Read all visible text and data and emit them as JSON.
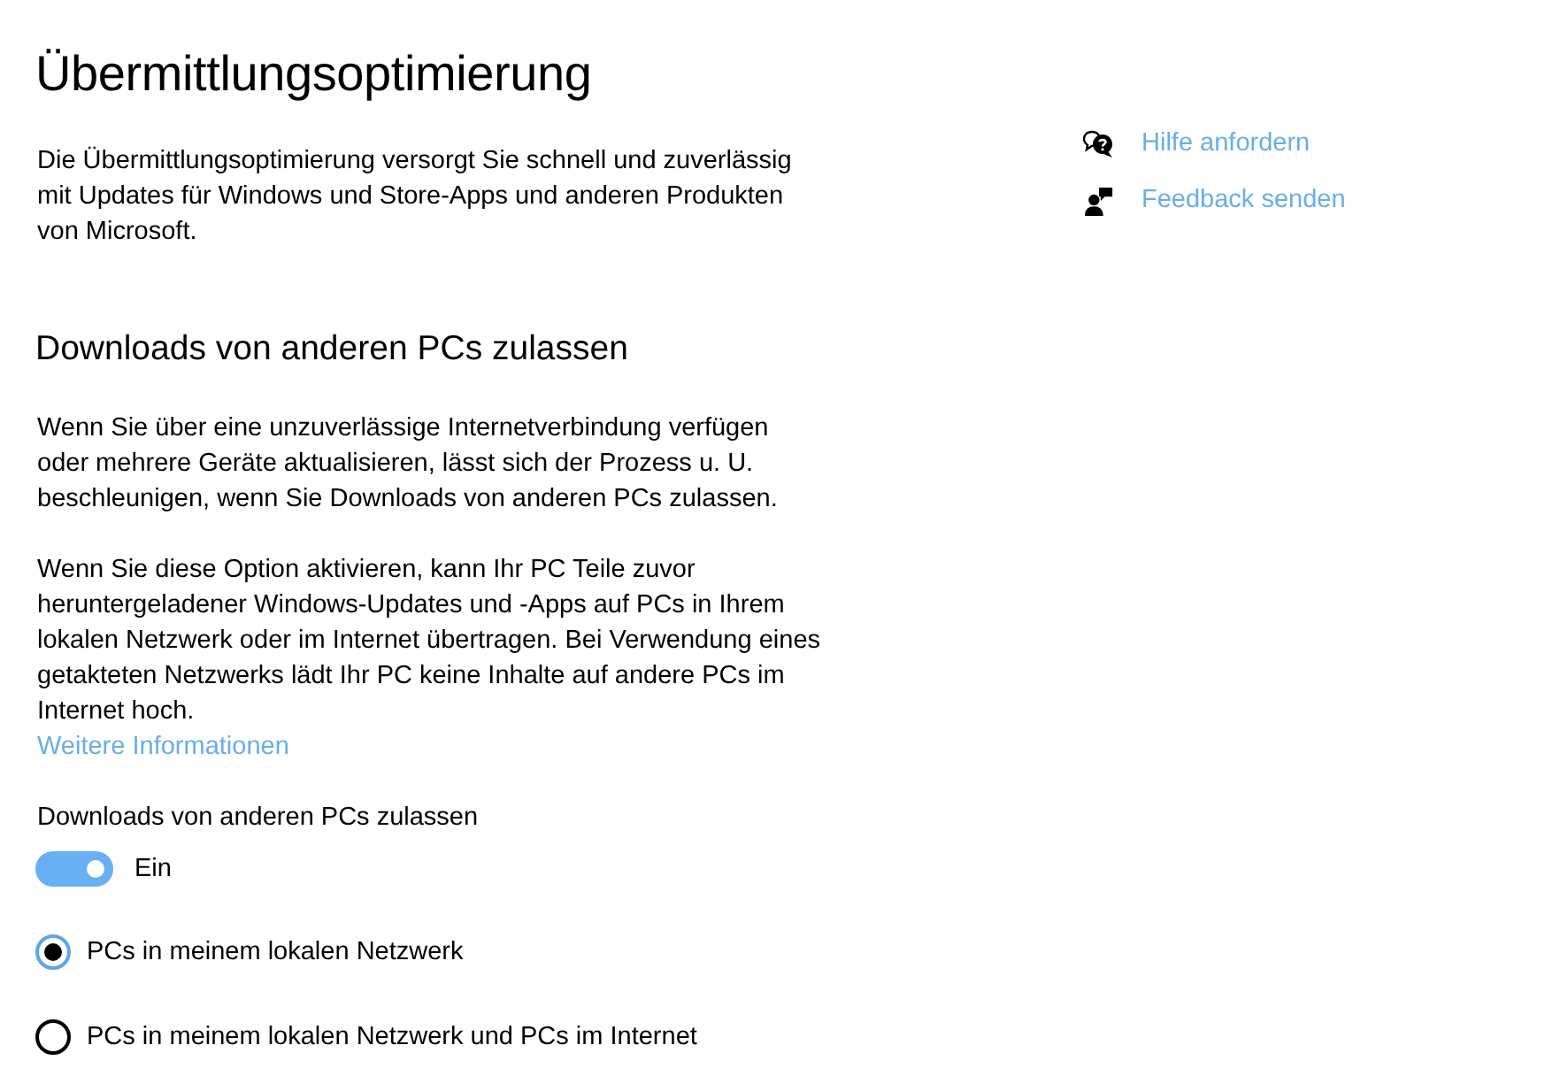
{
  "page": {
    "title": "Übermittlungsoptimierung",
    "description": "Die Übermittlungsoptimierung versorgt Sie schnell und zuverlässig mit Updates für Windows und Store-Apps und anderen Produkten von Microsoft."
  },
  "help_links": [
    {
      "label": "Hilfe anfordern",
      "kind": "help"
    },
    {
      "label": "Feedback senden",
      "kind": "feedback"
    }
  ],
  "section": {
    "heading": "Downloads von anderen PCs zulassen",
    "paragraphs": [
      "Wenn Sie über eine unzuverlässige Internetverbindung verfügen oder mehrere Geräte aktualisieren, lässt sich der Prozess u. U. beschleunigen, wenn Sie Downloads von anderen PCs zulassen.",
      "Wenn Sie diese Option aktivieren, kann Ihr PC Teile zuvor heruntergeladener Windows-Updates und -Apps auf PCs in Ihrem lokalen Netzwerk oder im Internet übertragen. Bei Verwendung eines getakteten Netzwerks lädt Ihr PC keine Inhalte auf andere PCs im Internet hoch."
    ],
    "link": "Weitere Informationen"
  },
  "toggle": {
    "label": "Downloads von anderen PCs zulassen",
    "on": true,
    "state_text": "Ein"
  },
  "options": [
    {
      "label": "PCs in meinem lokalen Netzwerk",
      "selected": true
    },
    {
      "label": "PCs in meinem lokalen Netzwerk und PCs im Internet",
      "selected": false
    }
  ]
}
